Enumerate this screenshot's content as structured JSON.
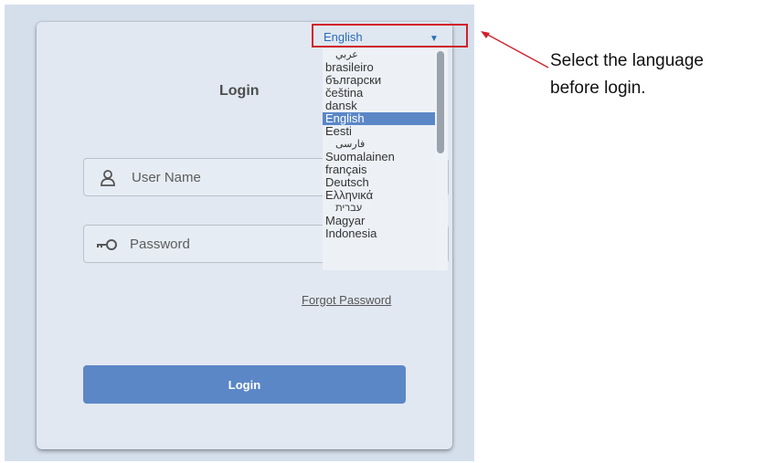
{
  "login": {
    "title": "Login",
    "username_placeholder": "User Name",
    "password_placeholder": "Password",
    "forgot_password": "Forgot Password",
    "button_label": "Login"
  },
  "language": {
    "selected": "English",
    "options": [
      "عربي",
      "brasileiro",
      "български",
      "čeština",
      "dansk",
      "English",
      "Eesti",
      "فارسی",
      "Suomalainen",
      "français",
      "Deutsch",
      "Ελληνικά",
      "עברית",
      "Magyar",
      "Indonesia"
    ]
  },
  "annotation": {
    "line1": "Select the language",
    "line2": "before login."
  },
  "colors": {
    "accent": "#5b87c7",
    "highlight": "#d11f2a",
    "link": "#2b6db6"
  },
  "icons": {
    "user": "user-icon",
    "password": "key-icon",
    "dropdown": "caret-down-icon"
  }
}
